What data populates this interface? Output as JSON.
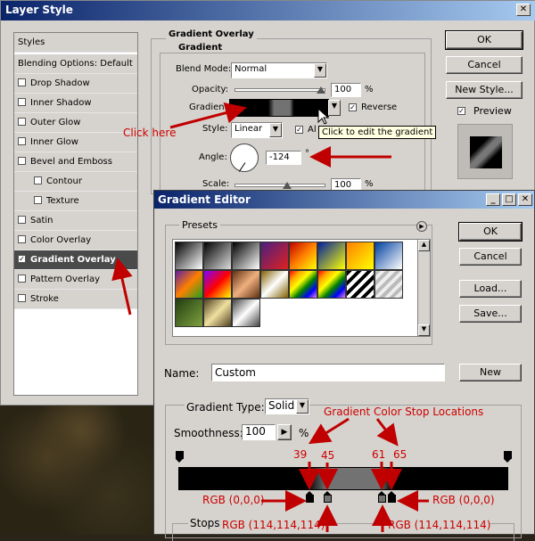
{
  "layer_style": {
    "title": "Layer Style",
    "styles_header": "Styles",
    "blending_options": "Blending Options: Default",
    "items": [
      {
        "label": "Drop Shadow",
        "checked": false
      },
      {
        "label": "Inner Shadow",
        "checked": false
      },
      {
        "label": "Outer Glow",
        "checked": false
      },
      {
        "label": "Inner Glow",
        "checked": false
      },
      {
        "label": "Bevel and Emboss",
        "checked": false
      },
      {
        "label": "Contour",
        "checked": false
      },
      {
        "label": "Texture",
        "checked": false
      },
      {
        "label": "Satin",
        "checked": false
      },
      {
        "label": "Color Overlay",
        "checked": false
      },
      {
        "label": "Gradient Overlay",
        "checked": true
      },
      {
        "label": "Pattern Overlay",
        "checked": false
      },
      {
        "label": "Stroke",
        "checked": false
      }
    ],
    "section_title": "Gradient Overlay",
    "subsection_title": "Gradient",
    "blend_mode_label": "Blend Mode:",
    "blend_mode_value": "Normal",
    "opacity_label": "Opacity:",
    "opacity_value": "100",
    "percent": "%",
    "gradient_label": "Gradient:",
    "reverse_label": "Reverse",
    "style_label": "Style:",
    "style_value": "Linear",
    "align_label": "Al",
    "angle_label": "Angle:",
    "angle_value": "-124",
    "degree": "°",
    "scale_label": "Scale:",
    "scale_value": "100",
    "ok": "OK",
    "cancel": "Cancel",
    "new_style": "New Style...",
    "preview": "Preview",
    "tooltip": "Click to edit the gradient",
    "click_here": "Click here"
  },
  "gradient_editor": {
    "title": "Gradient Editor",
    "presets_label": "Presets",
    "ok": "OK",
    "cancel": "Cancel",
    "load": "Load...",
    "save": "Save...",
    "name_label": "Name:",
    "name_value": "Custom",
    "new": "New",
    "gradient_type_label": "Gradient Type:",
    "gradient_type_value": "Solid",
    "smoothness_label": "Smoothness:",
    "smoothness_value": "100",
    "percent": "%",
    "stops_label": "Stops",
    "stop_locations_title": "Gradient Color Stop Locations",
    "stop_39": "39",
    "stop_45": "45",
    "stop_61": "61",
    "stop_65": "65",
    "rgb_left_black": "RGB (0,0,0)",
    "rgb_right_black": "RGB (0,0,0)",
    "rgb_left_gray": "RGB (114,114,114)",
    "rgb_right_gray": "RGB (114,114,114)"
  },
  "colors": {
    "annotation_red": "#cc0000",
    "gray_stop": "#727272",
    "title_blue": "#0a246a"
  }
}
